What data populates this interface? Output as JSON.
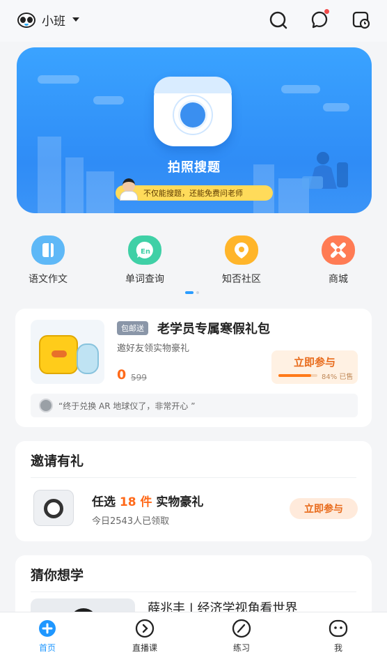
{
  "header": {
    "grade_label": "小班",
    "icons": [
      "panda-logo-icon",
      "search-icon",
      "message-icon",
      "clock-icon"
    ],
    "has_notification_dot": true
  },
  "banner": {
    "title": "拍照搜题",
    "tip": "不仅能搜题，还能免费问老师"
  },
  "quick_entries": [
    {
      "label": "语文作文",
      "icon": "composition-icon",
      "color": "#5eb8f7"
    },
    {
      "label": "单词查询",
      "icon": "word-lookup-icon",
      "color": "#3fd0a6"
    },
    {
      "label": "知否社区",
      "icon": "community-icon",
      "color": "#ffb52a"
    },
    {
      "label": "商城",
      "icon": "mall-icon",
      "color": "#ff7b54"
    }
  ],
  "promo": {
    "badge": "包邮送",
    "title": "老学员专属寒假礼包",
    "subtitle": "邀好友领实物豪礼",
    "price": "0",
    "original_price": "599",
    "join_label": "立即参与",
    "sold_text": "84% 已售",
    "sold_fraction": 0.84,
    "testimonial": "“终于兑换 AR 地球仪了，非常开心 ”"
  },
  "invite": {
    "title": "邀请有礼",
    "item_prefix": "任选 ",
    "item_highlight": "18 件",
    "item_suffix": " 实物豪礼",
    "subtitle": "今日2543人已领取",
    "join_label": "立即参与"
  },
  "guess": {
    "title": "猜你想学",
    "course_title": "薛兆丰 | 经济学视角看世界"
  },
  "tabbar": {
    "tabs": [
      {
        "label": "首页",
        "icon": "home-icon",
        "active": true
      },
      {
        "label": "直播课",
        "icon": "live-class-icon",
        "active": false
      },
      {
        "label": "练习",
        "icon": "practice-icon",
        "active": false
      },
      {
        "label": "我",
        "icon": "profile-icon",
        "active": false
      }
    ],
    "accent": "#1f97ff"
  }
}
